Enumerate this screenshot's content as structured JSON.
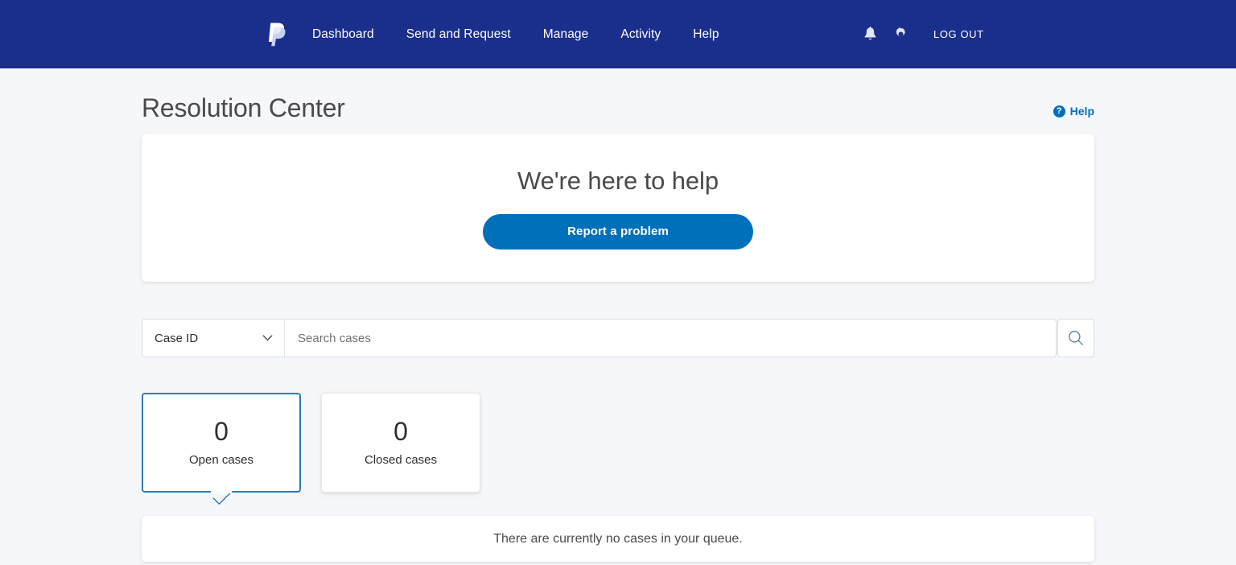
{
  "navbar": {
    "logo_name": "paypal-logo",
    "links": [
      {
        "label": "Dashboard"
      },
      {
        "label": "Send and Request"
      },
      {
        "label": "Manage"
      },
      {
        "label": "Activity"
      },
      {
        "label": "Help"
      }
    ],
    "notifications_icon": "bell-icon",
    "settings_icon": "gear-icon",
    "logout_label": "LOG OUT",
    "background_color": "#1a2e8c",
    "text_color": "#ffffff"
  },
  "header": {
    "title": "Resolution Center",
    "help": {
      "icon": "question-circle-icon",
      "label": "Help",
      "color": "#0070ba"
    }
  },
  "hero": {
    "title": "We're here to help",
    "button_label": "Report a problem",
    "button_color": "#0070ba"
  },
  "search": {
    "filter_selected": "Case ID",
    "filter_options": [
      "Case ID"
    ],
    "chevron_icon": "chevron-down-icon",
    "placeholder": "Search cases",
    "value": "",
    "search_icon": "search-icon"
  },
  "tiles": [
    {
      "count": "0",
      "label": "Open cases",
      "selected": true,
      "border_color": "#2b7cb3"
    },
    {
      "count": "0",
      "label": "Closed cases",
      "selected": false
    }
  ],
  "empty_state": {
    "message": "There are currently no cases in your queue."
  }
}
